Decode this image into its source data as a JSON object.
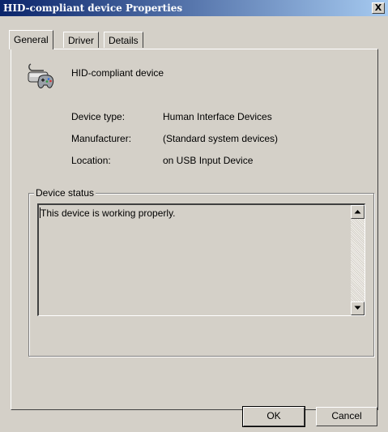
{
  "window": {
    "title": "HID-compliant device Properties",
    "close_glyph": "X"
  },
  "tabs": [
    {
      "label": "General",
      "active": true
    },
    {
      "label": "Driver",
      "active": false
    },
    {
      "label": "Details",
      "active": false
    }
  ],
  "device": {
    "icon": "hid-gamepad-icon",
    "name": "HID-compliant device",
    "properties": [
      {
        "label": "Device type:",
        "value": "Human Interface Devices"
      },
      {
        "label": "Manufacturer:",
        "value": "(Standard system devices)"
      },
      {
        "label": "Location:",
        "value": "on USB Input Device"
      }
    ]
  },
  "status": {
    "group_label": "Device status",
    "text": "This device is working properly."
  },
  "buttons": {
    "ok": "OK",
    "cancel": "Cancel"
  },
  "colors": {
    "face": "#d4d0c8",
    "title_start": "#0a246a",
    "title_end": "#a6caf0"
  }
}
